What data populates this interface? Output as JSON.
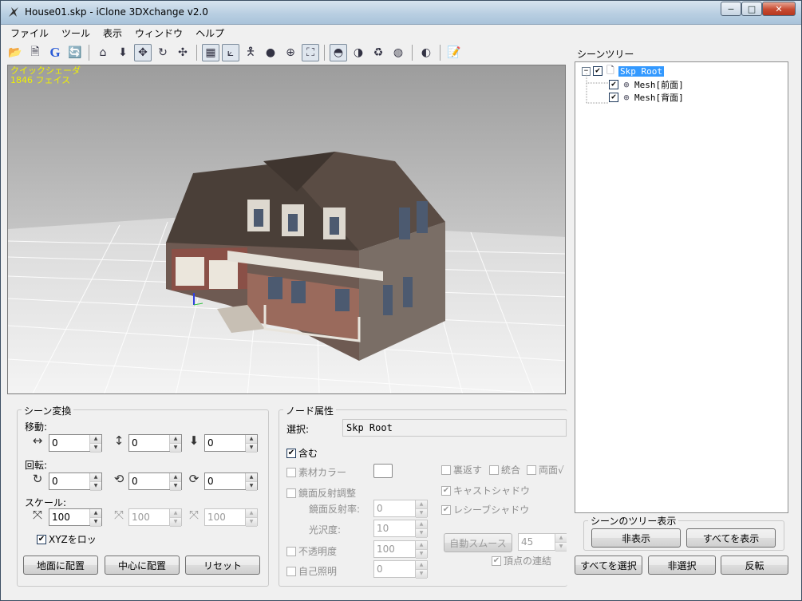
{
  "window": {
    "title": "House01.skp - iClone 3DXchange v2.0",
    "minimize": "−",
    "maximize": "□",
    "close": "✕"
  },
  "menu": [
    "ファイル",
    "ツール",
    "表示",
    "ウィンドウ",
    "ヘルプ"
  ],
  "viewport": {
    "shader": "クイックシェーダ",
    "faces": "1846 フェイス"
  },
  "scene_tree": {
    "title": "シーンツリー",
    "root": "Skp Root",
    "children": [
      "Mesh[前面]",
      "Mesh[背面]"
    ]
  },
  "tree_display": {
    "title": "シーンのツリー表示",
    "hide": "非表示",
    "show_all": "すべてを表示"
  },
  "tree_actions": {
    "select_all": "すべてを選択",
    "deselect": "非選択",
    "invert": "反転"
  },
  "scene_transform": {
    "title": "シーン変換",
    "move_label": "移動:",
    "move": [
      "0",
      "0",
      "0"
    ],
    "rotate_label": "回転:",
    "rotate": [
      "0",
      "0",
      "0"
    ],
    "scale_label": "スケール:",
    "scale": [
      "100",
      "100",
      "100"
    ],
    "xyz_lock": "XYZをロッ",
    "place_ground": "地面に配置",
    "place_center": "中心に配置",
    "reset": "リセット"
  },
  "node_props": {
    "title": "ノード属性",
    "select_label": "選択:",
    "select_value": "Skp Root",
    "include": "含む",
    "material_color": "素材カラー",
    "specular_adjust": "鏡面反射調整",
    "specular_rate": "鏡面反射率:",
    "specular_value": "0",
    "gloss": "光沢度:",
    "gloss_value": "10",
    "opacity": "不透明度",
    "opacity_value": "100",
    "self_illum": "自己照明",
    "self_illum_value": "0",
    "flip": "裏返す",
    "merge": "統合",
    "two_sided": "両面√",
    "cast_shadow": "キャストシャドウ",
    "receive_shadow": "レシーブシャドウ",
    "auto_smooth": "自動スムース",
    "auto_smooth_value": "45",
    "weld_vertices": "頂点の連結"
  },
  "colors": {
    "viewport_info": "#f0f000",
    "selection": "#3399ff"
  }
}
